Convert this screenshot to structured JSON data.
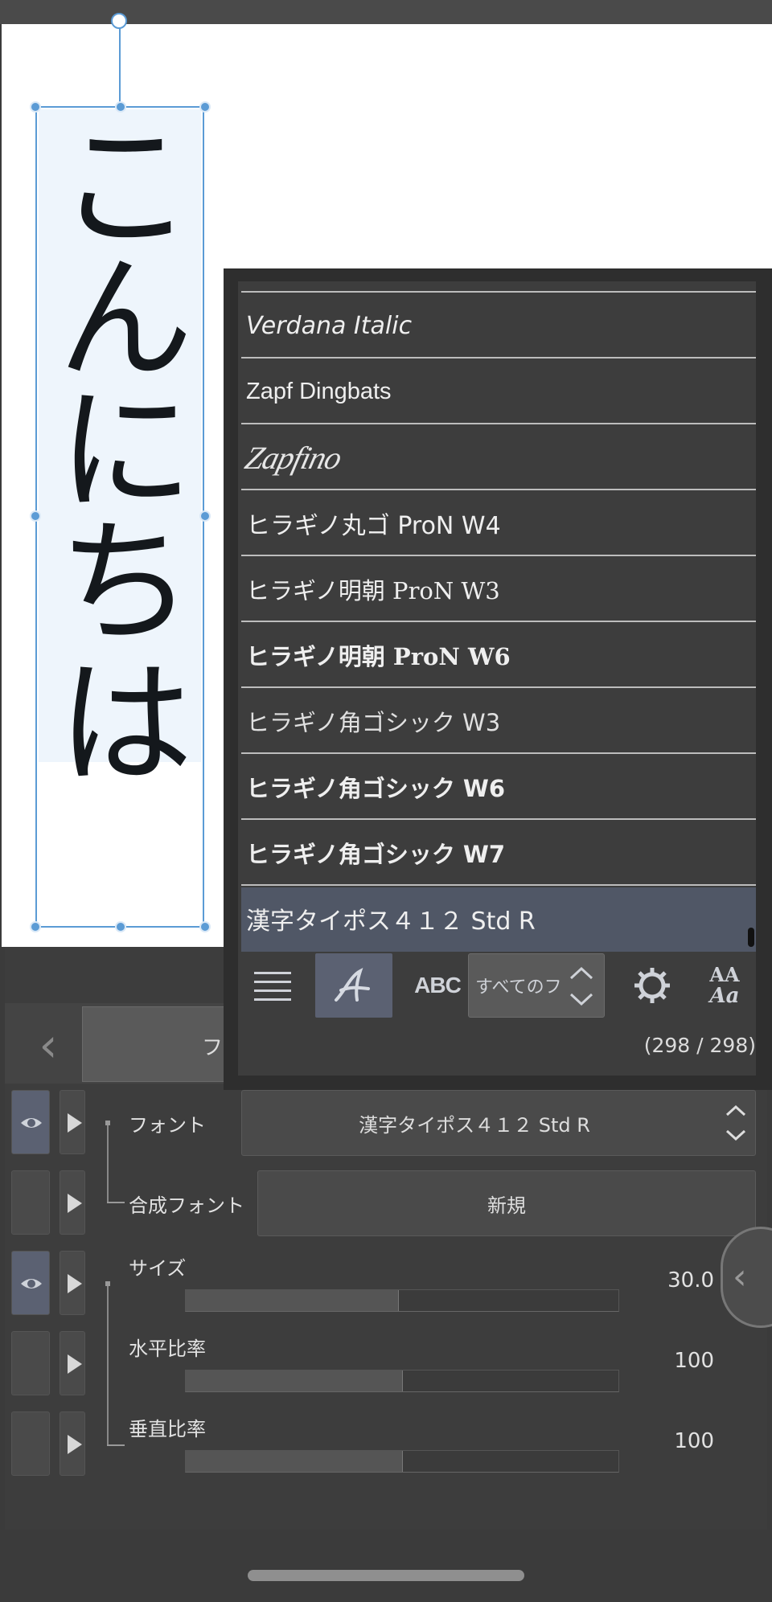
{
  "canvas": {
    "vertical_text": [
      "こ",
      "ん",
      "に",
      "ち",
      "は"
    ]
  },
  "font_list": {
    "items": [
      {
        "label": "Verdana Italic",
        "style": "italic",
        "weight": "normal"
      },
      {
        "label": "Zapf Dingbats",
        "style": "normal",
        "weight": "normal"
      },
      {
        "label": "Zapfino",
        "style": "script",
        "weight": "normal"
      },
      {
        "label": "ヒラギノ丸ゴ ProN W4",
        "style": "normal",
        "weight": "normal"
      },
      {
        "label": "ヒラギノ明朝 ProN W3",
        "style": "serif",
        "weight": "normal"
      },
      {
        "label": "ヒラギノ明朝 ProN W6",
        "style": "serif",
        "weight": "bold"
      },
      {
        "label": "ヒラギノ角ゴシック W3",
        "style": "normal",
        "weight": "light"
      },
      {
        "label": "ヒラギノ角ゴシック W6",
        "style": "normal",
        "weight": "bold"
      },
      {
        "label": "ヒラギノ角ゴシック W7",
        "style": "normal",
        "weight": "bold"
      },
      {
        "label": "漢字タイポス４１２ Std R",
        "style": "normal",
        "weight": "normal",
        "selected": true
      }
    ],
    "filter_value": "すべてのフ",
    "abc_label": "ABC",
    "aa_label": "AA",
    "aa_sub_label": "Aa",
    "count": "(298 / 298)"
  },
  "panel": {
    "tab_label": "フ",
    "font_label": "フォント",
    "font_value": "漢字タイポス４１２ Std R",
    "composite_label": "合成フォント",
    "composite_value": "新規",
    "size_label": "サイズ",
    "size_value": "30.0",
    "size_fraction": 0.49,
    "hratio_label": "水平比率",
    "hratio_value": "100",
    "hratio_fraction": 0.5,
    "vratio_label": "垂直比率",
    "vratio_value": "100",
    "vratio_fraction": 0.5
  },
  "colors": {
    "accent": "#5b9bd5",
    "selected_row": "#505766",
    "active_button": "#5b6172"
  }
}
